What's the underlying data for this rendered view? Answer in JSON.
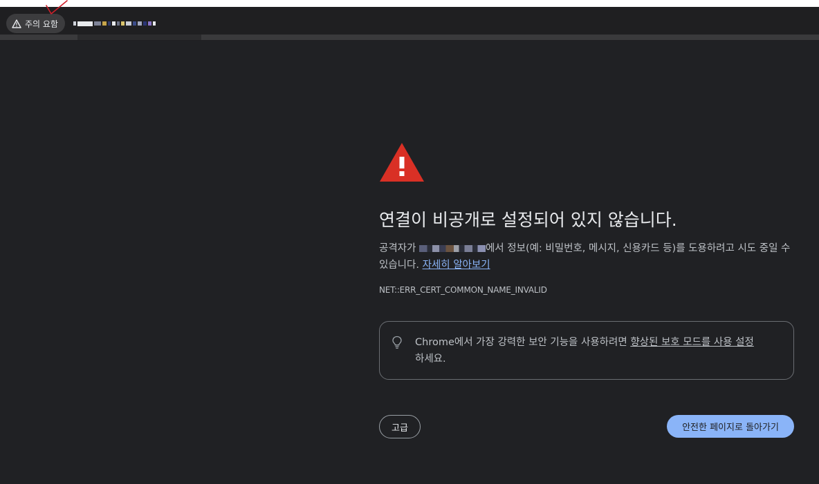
{
  "toolbar": {
    "security_chip_label": "주의 요함",
    "url_text": ""
  },
  "interstitial": {
    "title": "연결이 비공개로 설정되어 있지 않습니다.",
    "desc_prefix": "공격자가 ",
    "desc_suffix": "에서 정보(예: 비밀번호, 메시지, 신용카드 등)를 도용하려고 시도 중일 수 있습니다. ",
    "learn_more_link": "자세히 알아보기",
    "error_code": "NET::ERR_CERT_COMMON_NAME_INVALID",
    "enhanced_prefix": "Chrome에서 가장 강력한 보안 기능을 사용하려면 ",
    "enhanced_link": "향상된 보호 모드를 사용 설정",
    "enhanced_suffix": "하세요.",
    "advanced_button": "고급",
    "back_button": "안전한 페이지로 돌아가기"
  },
  "icons": {
    "security_chip_icon": "warning-triangle-icon",
    "main_icon": "warning-triangle-icon",
    "tip_icon": "lightbulb-icon"
  },
  "colors": {
    "background": "#202124",
    "warning_red": "#d93025",
    "link_blue": "#8ab4f8",
    "primary_button": "#8ab4f8"
  }
}
